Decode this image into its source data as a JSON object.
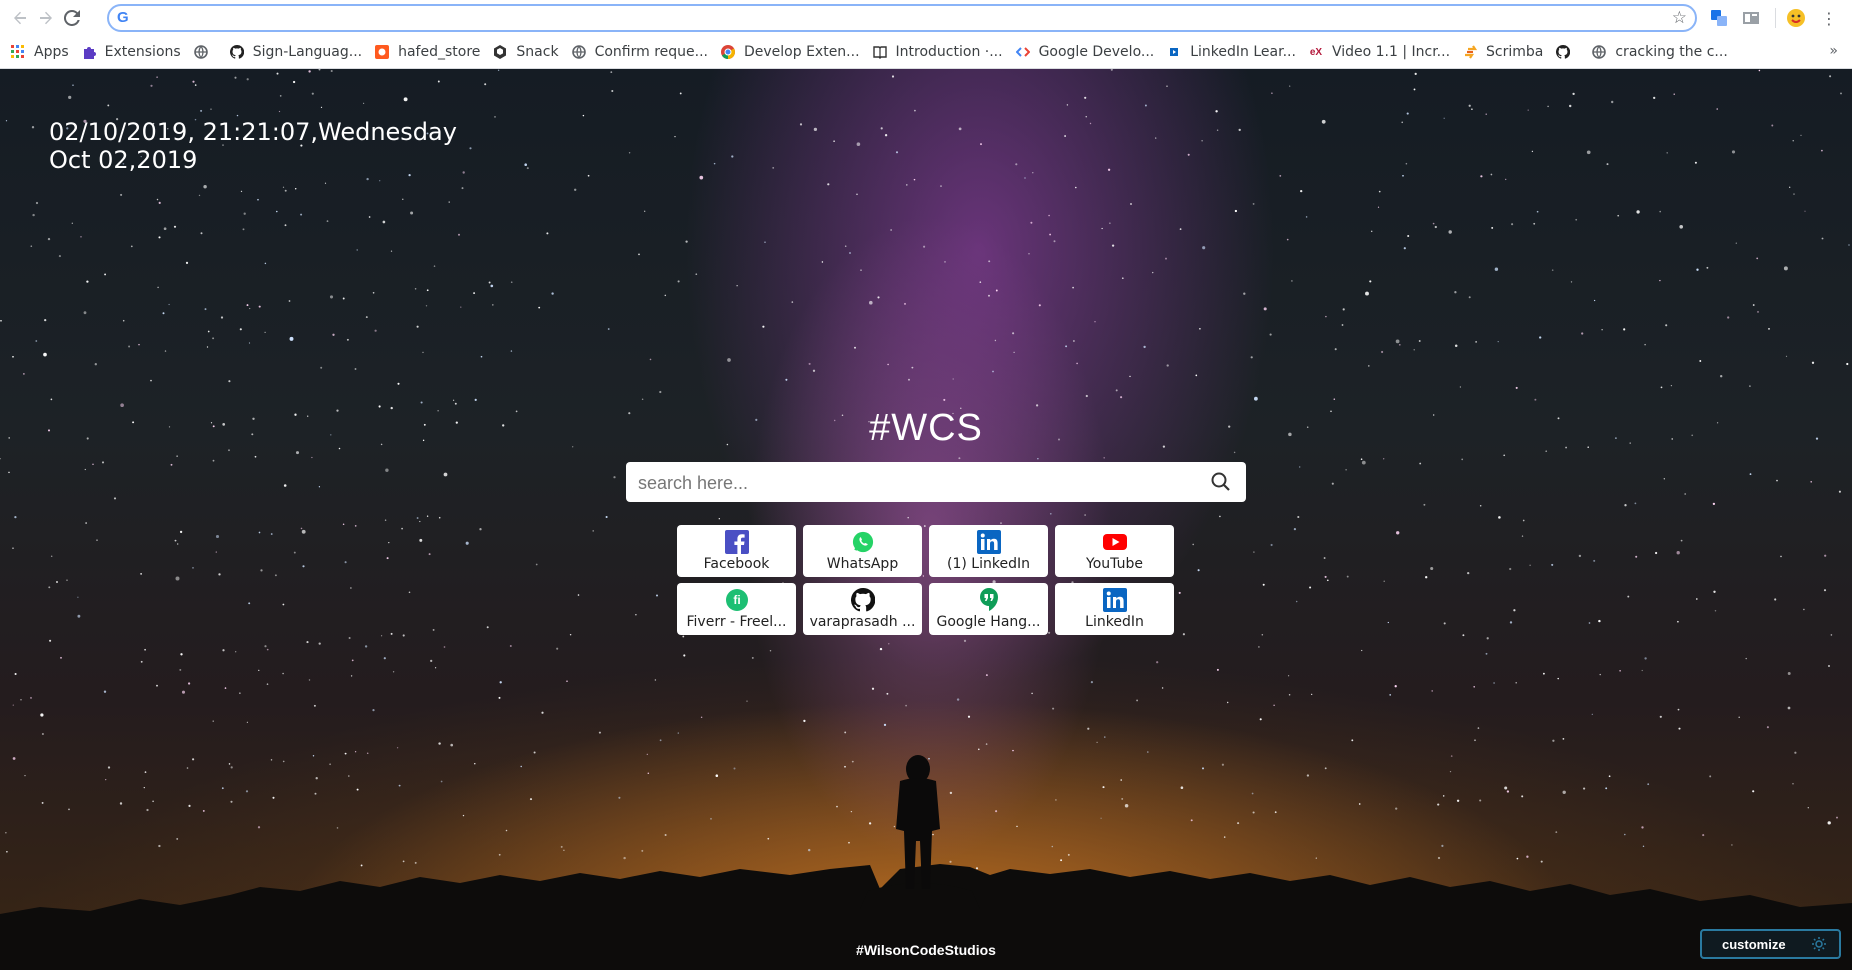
{
  "browser": {
    "address_bar": {
      "value": "",
      "search_engine_icon": "google-g-icon"
    },
    "nav": {
      "back_icon": "back-arrow-icon",
      "forward_icon": "forward-arrow-icon",
      "reload_icon": "reload-icon"
    },
    "bookmarks": [
      {
        "label": "Apps",
        "icon": "apps-grid-icon"
      },
      {
        "label": "Extensions",
        "icon": "puzzle-icon"
      },
      {
        "label": "",
        "icon": "globe-icon"
      },
      {
        "label": "Sign-Languag...",
        "icon": "github-icon"
      },
      {
        "label": "hafed_store",
        "icon": "store-icon"
      },
      {
        "label": "Snack",
        "icon": "snack-icon"
      },
      {
        "label": "Confirm reque...",
        "icon": "globe-icon"
      },
      {
        "label": "Develop Exten...",
        "icon": "chrome-icon"
      },
      {
        "label": "Introduction ·...",
        "icon": "book-icon"
      },
      {
        "label": "Google Develo...",
        "icon": "google-developers-icon"
      },
      {
        "label": "LinkedIn Lear...",
        "icon": "linkedin-learning-icon"
      },
      {
        "label": "Video 1.1 | Incr...",
        "icon": "edx-icon"
      },
      {
        "label": "Scrimba",
        "icon": "scrimba-icon"
      },
      {
        "label": "",
        "icon": "github-icon"
      },
      {
        "label": "cracking the c...",
        "icon": "globe-icon"
      }
    ]
  },
  "page": {
    "clock": {
      "line1": "02/10/2019, 21:21:07,Wednesday",
      "line2": "Oct 02,2019"
    },
    "brand_title": "#WCS",
    "search": {
      "placeholder": "search here...",
      "value": ""
    },
    "shortcuts": [
      {
        "label": "Facebook",
        "icon": "facebook-icon",
        "color": "#3b5998"
      },
      {
        "label": "WhatsApp",
        "icon": "whatsapp-icon",
        "color": "#25d366"
      },
      {
        "label": "(1) LinkedIn",
        "icon": "linkedin-icon",
        "color": "#0a66c2"
      },
      {
        "label": "YouTube",
        "icon": "youtube-icon",
        "color": "#ff0000"
      },
      {
        "label": "Fiverr - Freel...",
        "icon": "fiverr-icon",
        "color": "#1dbf73"
      },
      {
        "label": "varaprasadh ...",
        "icon": "github-icon",
        "color": "#111111"
      },
      {
        "label": "Google Hang...",
        "icon": "hangouts-icon",
        "color": "#0f9d58"
      },
      {
        "label": "LinkedIn",
        "icon": "linkedin-icon",
        "color": "#0a66c2"
      }
    ],
    "footer_brand": "#WilsonCodeStudios",
    "customize_label": "customize"
  }
}
